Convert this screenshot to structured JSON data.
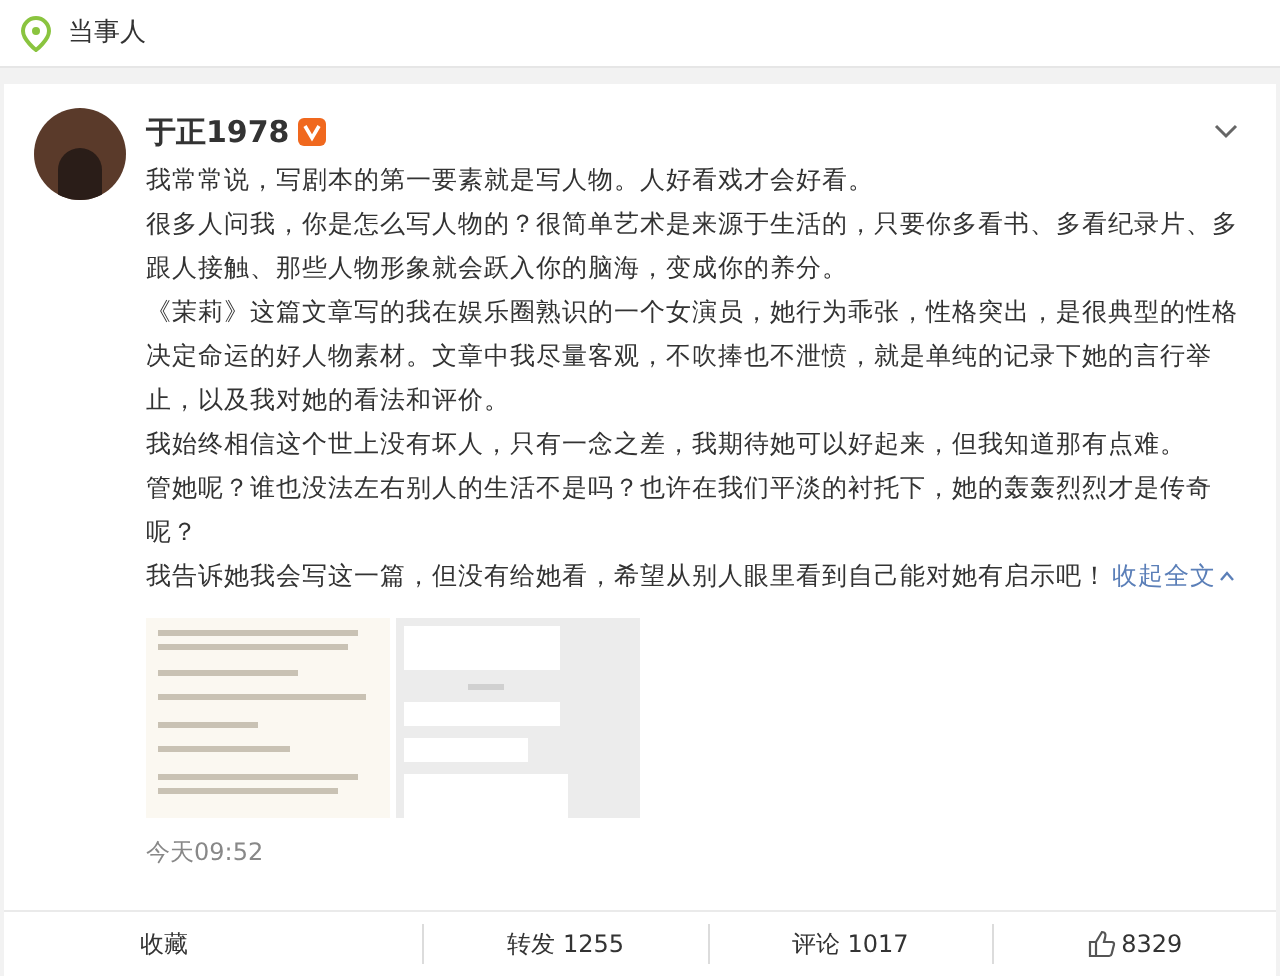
{
  "header": {
    "title": "当事人"
  },
  "post": {
    "author": "于正1978",
    "verified": true,
    "paragraphs": [
      "我常常说，写剧本的第一要素就是写人物。人好看戏才会好看。",
      "很多人问我，你是怎么写人物的？很简单艺术是来源于生活的，只要你多看书、多看纪录片、多跟人接触、那些人物形象就会跃入你的脑海，变成你的养分。",
      "《茉莉》这篇文章写的我在娱乐圈熟识的一个女演员，她行为乖张，性格突出，是很典型的性格决定命运的好人物素材。文章中我尽量客观，不吹捧也不泄愤，就是单纯的记录下她的言行举止，以及我对她的看法和评价。",
      "我始终相信这个世上没有坏人，只有一念之差，我期待她可以好起来，但我知道那有点难。",
      "管她呢？谁也没法左右别人的生活不是吗？也许在我们平淡的衬托下，她的轰轰烈烈才是传奇呢？",
      "我告诉她我会写这一篇，但没有给她看，希望从别人眼里看到自己能对她有启示吧！"
    ],
    "collapse_link": "收起全文",
    "time": "今天09:52"
  },
  "actions": [
    {
      "kind": "text",
      "label": "收藏"
    },
    {
      "kind": "text",
      "label": "转发 1255"
    },
    {
      "kind": "text",
      "label": "评论 1017"
    },
    {
      "kind": "like",
      "label": "8329"
    }
  ]
}
